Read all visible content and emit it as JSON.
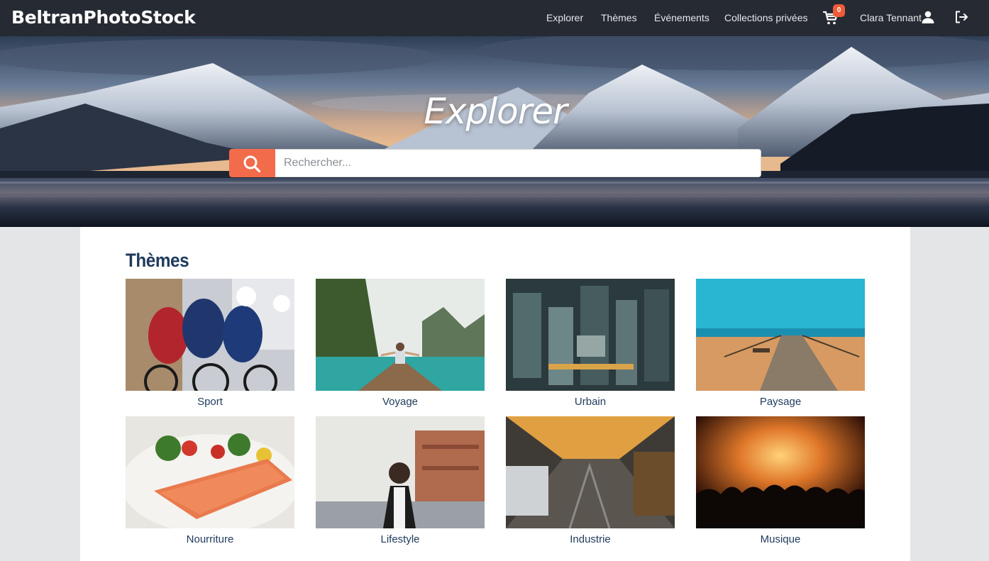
{
  "navbar": {
    "brand": "BeltranPhotoStock",
    "links": [
      "Explorer",
      "Thèmes",
      "Événements",
      "Collections privées"
    ],
    "cart_count": "0",
    "user_name": "Clara Tennant"
  },
  "hero": {
    "title": "Explorer",
    "search_placeholder": "Rechercher..."
  },
  "themes": {
    "title": "Thèmes",
    "items": [
      "Sport",
      "Voyage",
      "Urbain",
      "Paysage",
      "Nourriture",
      "Lifestyle",
      "Industrie",
      "Musique"
    ]
  },
  "colors": {
    "navbar_bg": "#262a33",
    "accent": "#f26b4a",
    "heading": "#1e3a5c"
  },
  "icons": [
    "cart-icon",
    "user-icon",
    "logout-icon",
    "search-icon"
  ]
}
